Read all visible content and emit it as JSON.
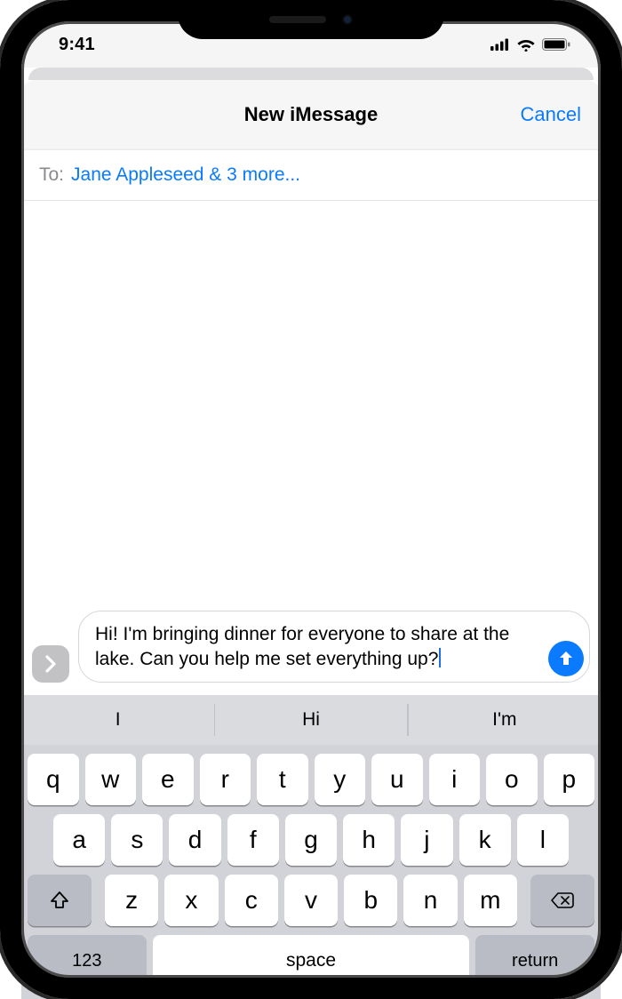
{
  "status": {
    "time": "9:41"
  },
  "nav": {
    "title": "New iMessage",
    "cancel": "Cancel"
  },
  "to": {
    "label": "To:",
    "value": "Jane Appleseed & 3 more..."
  },
  "compose": {
    "text": "Hi! I'm bringing dinner for everyone to share at the lake. Can you help me set everything up?"
  },
  "predictions": {
    "a": "I",
    "b": "Hi",
    "c": "I'm"
  },
  "keys": {
    "row1": [
      "q",
      "w",
      "e",
      "r",
      "t",
      "y",
      "u",
      "i",
      "o",
      "p"
    ],
    "row2": [
      "a",
      "s",
      "d",
      "f",
      "g",
      "h",
      "j",
      "k",
      "l"
    ],
    "row3": [
      "z",
      "x",
      "c",
      "v",
      "b",
      "n",
      "m"
    ],
    "numKey": "123",
    "space": "space",
    "returnKey": "return"
  }
}
